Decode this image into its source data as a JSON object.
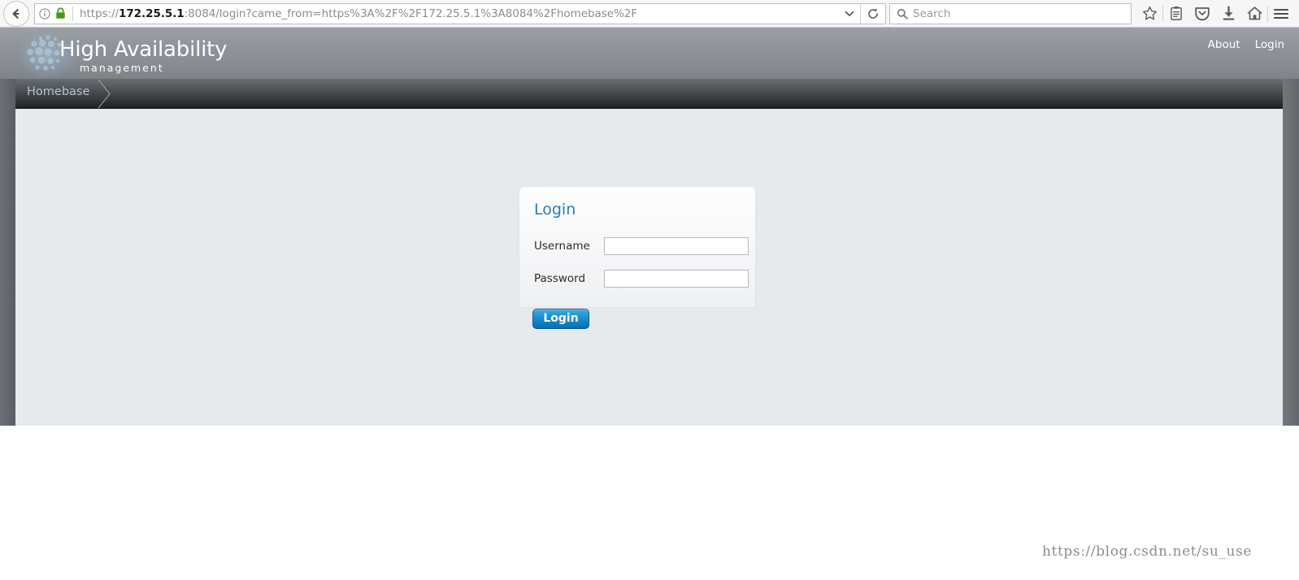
{
  "browser": {
    "back_label": "Back",
    "info_icon": "info-icon",
    "lock_icon": "padlock-icon",
    "url_scheme": "https://",
    "url_host": "172.25.5.1",
    "url_rest": ":8084/login?came_from=https%3A%2F%2F172.25.5.1%3A8084%2Fhomebase%2F",
    "url_full": "https://172.25.5.1:8084/login?came_from=https%3A%2F%2F172.25.5.1%3A8084%2Fhomebase%2F",
    "dropdown_icon": "chevron-down-icon",
    "reload_icon": "reload-icon",
    "search_placeholder": "Search",
    "search_value": "",
    "search_icon": "search-icon",
    "toolbar_icons": [
      {
        "name": "bookmark-star-icon",
        "label": "Bookmark this page"
      },
      {
        "name": "reader-view-icon",
        "label": "Reader view"
      },
      {
        "name": "pocket-icon",
        "label": "Save to Pocket"
      },
      {
        "name": "downloads-icon",
        "label": "Downloads"
      },
      {
        "name": "home-icon",
        "label": "Home"
      },
      {
        "name": "menu-hamburger-icon",
        "label": "Open menu"
      }
    ]
  },
  "header": {
    "brand_title": "High Availability",
    "brand_subtitle": "management",
    "logo_icon": "honeycomb-dots-logo",
    "links": [
      {
        "label": "About"
      },
      {
        "label": "Login"
      }
    ]
  },
  "breadcrumb": {
    "items": [
      {
        "label": "Homebase"
      }
    ],
    "separator_icon": "chevron-right-icon"
  },
  "login_form": {
    "heading": "Login",
    "fields": [
      {
        "label": "Username",
        "value": "",
        "placeholder": "",
        "type": "text",
        "name": "username-input"
      },
      {
        "label": "Password",
        "value": "",
        "placeholder": "",
        "type": "password",
        "name": "password-input"
      }
    ],
    "submit_label": "Login"
  },
  "watermark": {
    "text": "https://blog.csdn.net/su_use"
  },
  "colors": {
    "accent_blue": "#2580b8",
    "button_blue": "#0f81c4",
    "header_gray": "#8d9298",
    "content_bg": "#e7eaec",
    "page_bg": "#383a3c",
    "crumb_text": "#b4c4ce",
    "lock_green": "#3f9e0f"
  }
}
